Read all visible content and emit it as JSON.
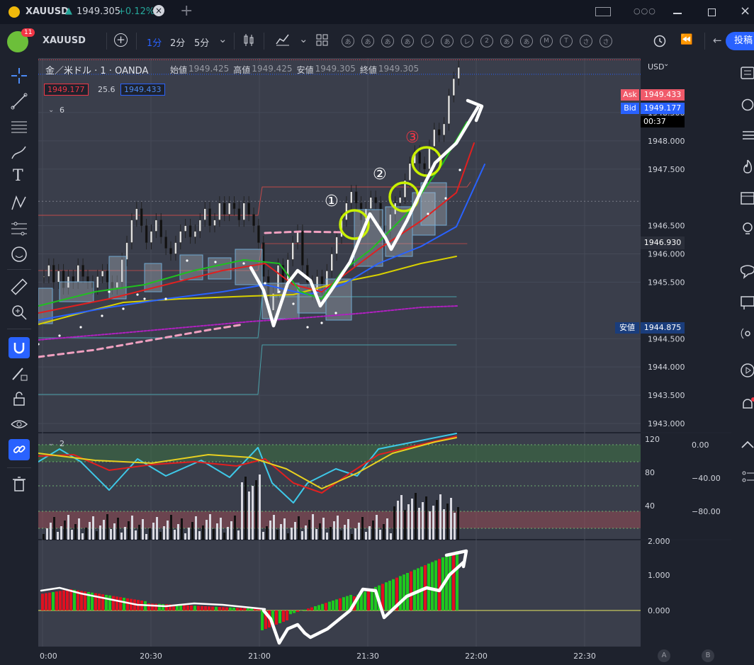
{
  "titlebar": {
    "symbol": "XAUUSD",
    "arrow": "▲",
    "price": "1949.305",
    "change": "+0.12%",
    "new_tab": "+",
    "dots": "○○○"
  },
  "toolbar": {
    "avatar_badge": "11",
    "symbol": "XAUUSD",
    "add": "+",
    "intervals": [
      "1分",
      "2分",
      "5分"
    ],
    "chevron": "⌄",
    "buttons": [
      "あ",
      "あ",
      "あ",
      "あ",
      "レ",
      "あ",
      "レ",
      "2",
      "あ",
      "あ",
      "M",
      "T",
      "さ",
      "さ"
    ],
    "back_arrow": "←",
    "publish": "投稿"
  },
  "chart": {
    "instrument": "金／米ドル · 1 · OANDA",
    "ohlc": [
      {
        "k": "始値",
        "v": "1949.425"
      },
      {
        "k": "高値",
        "v": "1949.425"
      },
      {
        "k": "安値",
        "v": "1949.305"
      },
      {
        "k": "終値",
        "v": "1949.305"
      }
    ],
    "bid": "1949.177",
    "spread": "25.6",
    "ask": "1949.433",
    "indicators_count": "6",
    "currency": "USD",
    "currency_chevron": "⌄",
    "price_ticks": [
      "1948.500",
      "1948.000",
      "1947.500",
      "1946.500",
      "1946.000",
      "1945.500",
      "1944.500",
      "1944.000",
      "1943.500",
      "1943.000"
    ],
    "tags": {
      "ask_label": "Ask",
      "ask_value": "1949.433",
      "bid_label": "Bid",
      "bid_value": "1949.177",
      "countdown": "00:37",
      "crosshair": "1946.930",
      "low_label": "安値",
      "low_value": "1944.875"
    },
    "annotations": {
      "one": "①",
      "two": "②",
      "three": "③"
    },
    "osc_count": "2",
    "osc_left_ticks": [
      "120",
      "80",
      "40"
    ],
    "osc_right_ticks": [
      "0.00",
      "−40.00",
      "−80.00"
    ],
    "macd_ticks": [
      "2.000",
      "1.000",
      "0.000"
    ],
    "time_ticks": [
      "0:00",
      "20:30",
      "21:00",
      "21:30",
      "22:00",
      "22:30"
    ],
    "corner_a": "A",
    "corner_b": "B"
  },
  "colors": {
    "bg": "#1e222d",
    "plot_bg": "#3a3e4b",
    "ask_red": "#f23645",
    "bid_blue": "#2962ff",
    "up_green": "#00c800",
    "down_red": "#e01020",
    "highlight": "#c8f000"
  }
}
